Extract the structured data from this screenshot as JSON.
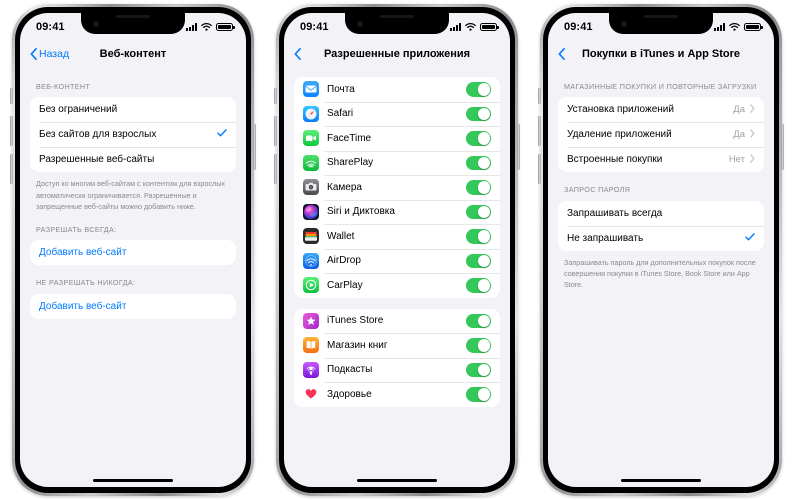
{
  "statusbar": {
    "time": "09:41",
    "signal_icon": "cellular-signal-icon",
    "wifi_icon": "wifi-icon",
    "battery_icon": "battery-icon"
  },
  "phones": [
    {
      "id": "web-content",
      "nav": {
        "back_label": "Назад",
        "back_icon": "chevron-left-icon",
        "title": "Веб-контент"
      },
      "sections": [
        {
          "header": "ВЕБ-КОНТЕНТ",
          "rows": [
            {
              "label": "Без ограничений",
              "checked": false
            },
            {
              "label": "Без сайтов для взрослых",
              "checked": true
            },
            {
              "label": "Разрешенные веб-сайты",
              "checked": false
            }
          ],
          "footnote": "Доступ ко многим веб-сайтам с контентом для взрослых автоматически ограничивается. Разрешенные и запрещенные веб-сайты можно добавить ниже."
        },
        {
          "header": "РАЗРЕШАТЬ ВСЕГДА:",
          "rows": [
            {
              "label": "Добавить веб-сайт",
              "link": true
            }
          ]
        },
        {
          "header": "НЕ РАЗРЕШАТЬ НИКОГДА:",
          "rows": [
            {
              "label": "Добавить веб-сайт",
              "link": true
            }
          ]
        }
      ]
    },
    {
      "id": "allowed-apps",
      "nav": {
        "back_label": "",
        "back_icon": "chevron-left-icon",
        "title": "Разрешенные приложения"
      },
      "groups": [
        {
          "apps": [
            {
              "label": "Почта",
              "icon": "mail-icon",
              "on": true
            },
            {
              "label": "Safari",
              "icon": "safari-icon",
              "on": true
            },
            {
              "label": "FaceTime",
              "icon": "facetime-icon",
              "on": true
            },
            {
              "label": "SharePlay",
              "icon": "shareplay-icon",
              "on": true
            },
            {
              "label": "Камера",
              "icon": "camera-icon",
              "on": true
            },
            {
              "label": "Siri и Диктовка",
              "icon": "siri-icon",
              "on": true
            },
            {
              "label": "Wallet",
              "icon": "wallet-icon",
              "on": true
            },
            {
              "label": "AirDrop",
              "icon": "airdrop-icon",
              "on": true
            },
            {
              "label": "CarPlay",
              "icon": "carplay-icon",
              "on": true
            }
          ]
        },
        {
          "apps": [
            {
              "label": "iTunes Store",
              "icon": "itunes-store-icon",
              "on": true
            },
            {
              "label": "Магазин книг",
              "icon": "book-store-icon",
              "on": true
            },
            {
              "label": "Подкасты",
              "icon": "podcasts-icon",
              "on": true
            },
            {
              "label": "Здоровье",
              "icon": "health-icon",
              "on": true
            }
          ]
        }
      ]
    },
    {
      "id": "itunes-app-store-purchases",
      "nav": {
        "back_label": "",
        "back_icon": "chevron-left-icon",
        "title": "Покупки в iTunes и App Store"
      },
      "sections": [
        {
          "header": "МАГАЗИННЫЕ ПОКУПКИ И ПОВТОРНЫЕ ЗАГРУЗКИ",
          "rows": [
            {
              "label": "Установка приложений",
              "value": "Да",
              "chevron": true
            },
            {
              "label": "Удаление приложений",
              "value": "Да",
              "chevron": true
            },
            {
              "label": "Встроенные покупки",
              "value": "Нет",
              "chevron": true
            }
          ]
        },
        {
          "header": "ЗАПРОС ПАРОЛЯ",
          "rows": [
            {
              "label": "Запрашивать всегда",
              "checked": false
            },
            {
              "label": "Не запрашивать",
              "checked": true
            }
          ],
          "footnote": "Запрашивать пароль для дополнительных покупок после совершения покупки в iTunes Store, Book Store или App Store."
        }
      ]
    }
  ],
  "colors": {
    "accent_blue": "#007aff",
    "toggle_green": "#34c759",
    "screen_bg": "#f2f2f7",
    "card_bg": "#ffffff",
    "secondary_text": "#8a8a8e"
  }
}
